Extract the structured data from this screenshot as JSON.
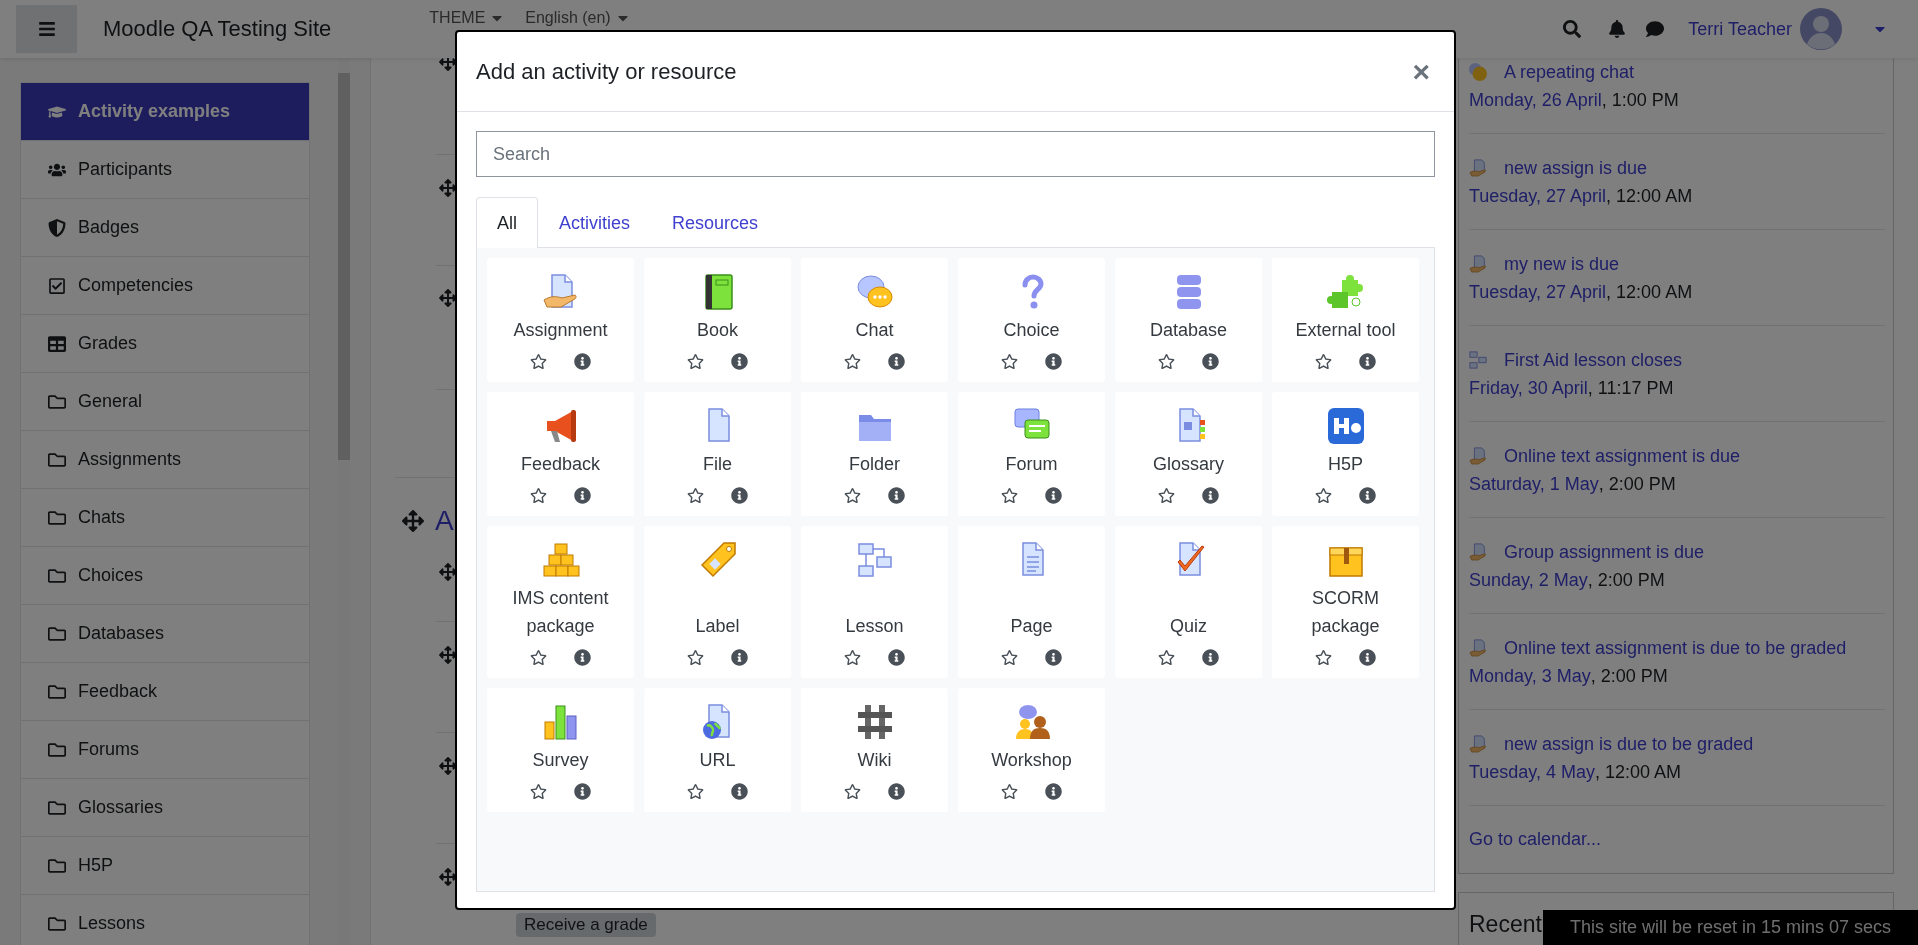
{
  "navbar": {
    "site_name": "Moodle QA Testing Site",
    "menus": [
      {
        "label": "THEME"
      },
      {
        "label": "English (en)"
      }
    ],
    "user_name": "Terri Teacher"
  },
  "drawer": {
    "items": [
      {
        "label": "Activity examples",
        "kind": "course",
        "selected": true
      },
      {
        "label": "Participants",
        "kind": "participants",
        "selected": false
      },
      {
        "label": "Badges",
        "kind": "badges",
        "selected": false
      },
      {
        "label": "Competencies",
        "kind": "competencies",
        "selected": false
      },
      {
        "label": "Grades",
        "kind": "grades",
        "selected": false
      },
      {
        "label": "General",
        "kind": "folder",
        "selected": false
      },
      {
        "label": "Assignments",
        "kind": "folder",
        "selected": false
      },
      {
        "label": "Chats",
        "kind": "folder",
        "selected": false
      },
      {
        "label": "Choices",
        "kind": "folder",
        "selected": false
      },
      {
        "label": "Databases",
        "kind": "folder",
        "selected": false
      },
      {
        "label": "Feedback",
        "kind": "folder",
        "selected": false
      },
      {
        "label": "Forums",
        "kind": "folder",
        "selected": false
      },
      {
        "label": "Glossaries",
        "kind": "folder",
        "selected": false
      },
      {
        "label": "H5P",
        "kind": "folder",
        "selected": false
      },
      {
        "label": "Lessons",
        "kind": "folder",
        "selected": false
      }
    ]
  },
  "course": {
    "section_title": "A",
    "badge": "Receive a grade"
  },
  "upcoming_events": {
    "events": [
      {
        "title": "A repeating chat",
        "date": "Monday, 26 April",
        "time": ", 1:00 PM",
        "kind": "chat"
      },
      {
        "title": "new assign is due",
        "date": "Tuesday, 27 April",
        "time": ", 12:00 AM",
        "kind": "assign"
      },
      {
        "title": "my new is due",
        "date": "Tuesday, 27 April",
        "time": ", 12:00 AM",
        "kind": "assign"
      },
      {
        "title": "First Aid lesson closes",
        "date": "Friday, 30 April",
        "time": ", 11:17 PM",
        "kind": "lesson"
      },
      {
        "title": "Online text assignment is due",
        "date": "Saturday, 1 May",
        "time": ", 2:00 PM",
        "kind": "assign"
      },
      {
        "title": "Group assignment is due",
        "date": "Sunday, 2 May",
        "time": ", 2:00 PM",
        "kind": "assign"
      },
      {
        "title": "Online text assignment is due to be graded",
        "date": "Monday, 3 May",
        "time": ", 2:00 PM",
        "kind": "assign"
      },
      {
        "title": "new assign is due to be graded",
        "date": "Tuesday, 4 May",
        "time": ", 12:00 AM",
        "kind": "assign"
      }
    ],
    "calendar_link": "Go to calendar..."
  },
  "recent_block": {
    "title": "Recent"
  },
  "reset_notice": "This site will be reset in 15 mins 07 secs",
  "modal": {
    "title": "Add an activity or resource",
    "close": "×",
    "search": {
      "placeholder": "Search"
    },
    "tabs": [
      {
        "label": "All",
        "selected": true
      },
      {
        "label": "Activities",
        "selected": false
      },
      {
        "label": "Resources",
        "selected": false
      }
    ],
    "modules": [
      {
        "name": "Assignment",
        "kind": "assignment",
        "starred": false
      },
      {
        "name": "Book",
        "kind": "book",
        "starred": false
      },
      {
        "name": "Chat",
        "kind": "chat",
        "starred": false
      },
      {
        "name": "Choice",
        "kind": "choice",
        "starred": false
      },
      {
        "name": "Database",
        "kind": "database",
        "starred": false
      },
      {
        "name": "External tool",
        "kind": "externaltool",
        "starred": false
      },
      {
        "name": "Feedback",
        "kind": "feedback",
        "starred": false
      },
      {
        "name": "File",
        "kind": "file",
        "starred": false
      },
      {
        "name": "Folder",
        "kind": "folder",
        "starred": false
      },
      {
        "name": "Forum",
        "kind": "forum",
        "starred": false
      },
      {
        "name": "Glossary",
        "kind": "glossary",
        "starred": false
      },
      {
        "name": "H5P",
        "kind": "h5p",
        "starred": false
      },
      {
        "name": "IMS content package",
        "kind": "imscp",
        "starred": false
      },
      {
        "name": "Label",
        "kind": "label",
        "starred": false
      },
      {
        "name": "Lesson",
        "kind": "lesson",
        "starred": false
      },
      {
        "name": "Page",
        "kind": "page",
        "starred": false
      },
      {
        "name": "Quiz",
        "kind": "quiz",
        "starred": false
      },
      {
        "name": "SCORM package",
        "kind": "scorm",
        "starred": false
      },
      {
        "name": "Survey",
        "kind": "survey",
        "starred": false
      },
      {
        "name": "URL",
        "kind": "url",
        "starred": false
      },
      {
        "name": "Wiki",
        "kind": "wiki",
        "starred": false
      },
      {
        "name": "Workshop",
        "kind": "workshop",
        "starred": false
      }
    ]
  }
}
